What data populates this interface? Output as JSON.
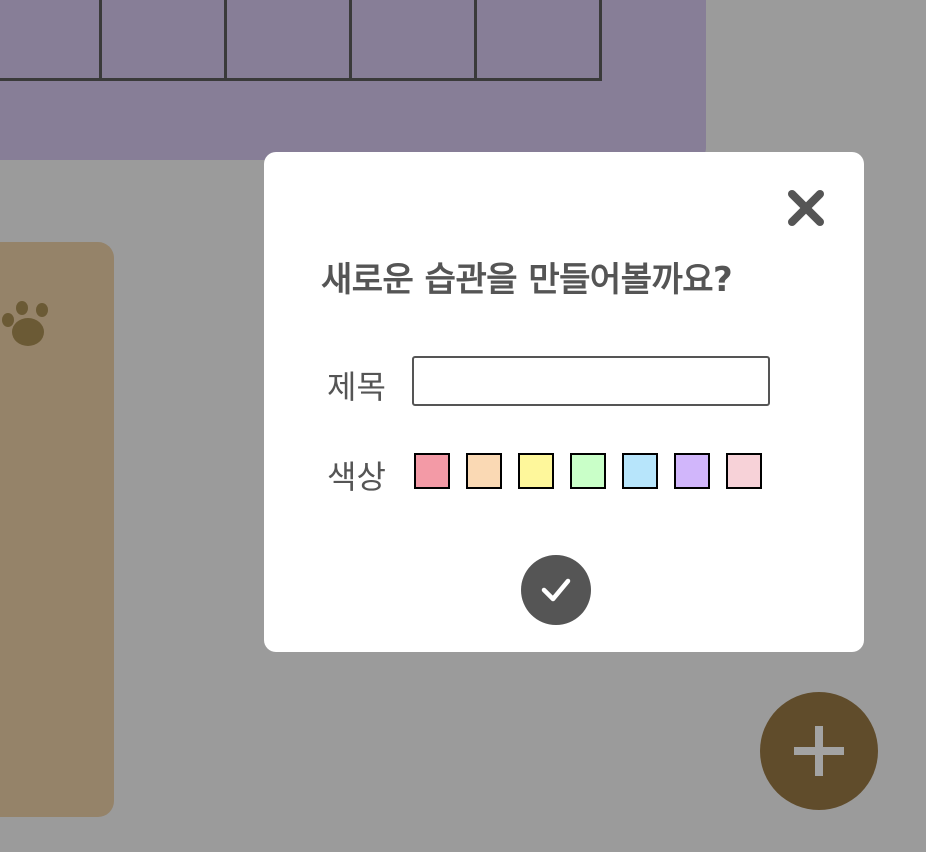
{
  "modal": {
    "title": "새로운 습관을 만들어볼까요?",
    "title_label": "제목",
    "title_input_value": "",
    "color_label": "색상",
    "colors": [
      "#f39aa6",
      "#fad9b4",
      "#fef79b",
      "#c9ffc8",
      "#b7e5fb",
      "#d1b6fb",
      "#f7d2d8"
    ]
  },
  "icons": {
    "close": "close-icon",
    "confirm": "check-icon",
    "add": "plus-icon",
    "paw": "paw-icon"
  },
  "theme": {
    "overlay": "#9b9b9b",
    "purple_card": "#877e97",
    "brown_card": "#958369",
    "fab": "#604c2b",
    "dark": "#555555"
  }
}
